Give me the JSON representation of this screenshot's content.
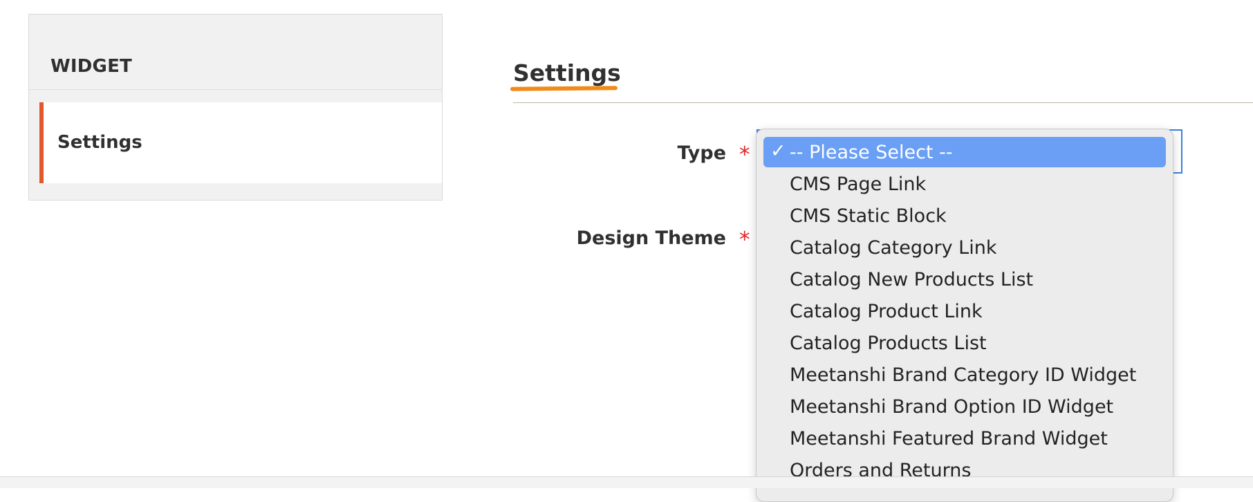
{
  "sidebar": {
    "title": "WIDGET",
    "items": [
      {
        "label": "Settings",
        "active": true
      }
    ]
  },
  "section": {
    "title": "Settings"
  },
  "form": {
    "type_label": "Type",
    "theme_label": "Design Theme",
    "required_marker": "*"
  },
  "dropdown": {
    "check_mark": "✓",
    "selected_index": 0,
    "options": [
      "-- Please Select --",
      "CMS Page Link",
      "CMS Static Block",
      "Catalog Category Link",
      "Catalog New Products List",
      "Catalog Product Link",
      "Catalog Products List",
      "Meetanshi Brand Category ID Widget",
      "Meetanshi Brand Option ID Widget",
      "Meetanshi Featured Brand Widget",
      "Orders and Returns"
    ]
  },
  "colors": {
    "accent_tab": "#e0582c",
    "section_underline": "#f08b1a",
    "required_star": "#e22626",
    "selected_option": "#6a9ff5",
    "focus_border": "#3a80d9"
  }
}
